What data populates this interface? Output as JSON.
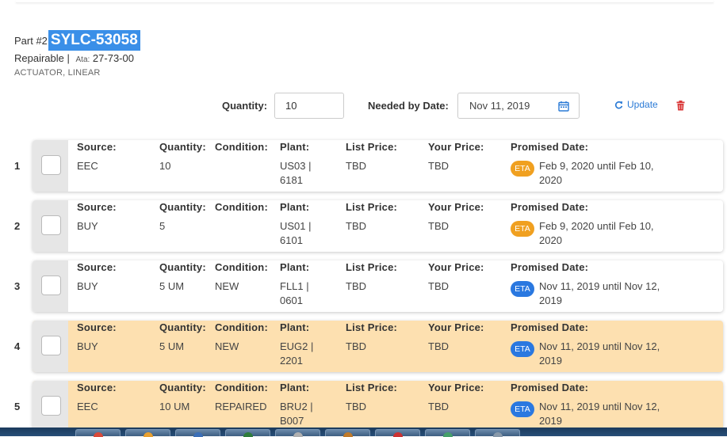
{
  "part": {
    "prefix": "Part #2",
    "number": "SYLC-53058",
    "repairable": "Repairable |",
    "ata_label": "Ata:",
    "ata_value": "27-73-00",
    "description": "ACTUATOR, LINEAR"
  },
  "controls": {
    "quantity_label": "Quantity:",
    "quantity_value": "10",
    "needed_label": "Needed by Date:",
    "needed_value": "Nov 11, 2019",
    "update_label": "Update"
  },
  "columns": {
    "source": "Source:",
    "quantity": "Quantity:",
    "condition": "Condition:",
    "plant": "Plant:",
    "list_price": "List Price:",
    "your_price": "Your Price:",
    "promised": "Promised Date:"
  },
  "eta_label": "ETA",
  "rows": [
    {
      "num": "1",
      "source": "EEC",
      "quantity": "10",
      "condition": "",
      "plant1": "US03 |",
      "plant2": "6181",
      "list_price": "TBD",
      "your_price": "TBD",
      "promised": "Feb 9, 2020 until Feb 10, 2020",
      "eta_color": "orange",
      "highlight": false
    },
    {
      "num": "2",
      "source": "BUY",
      "quantity": "5",
      "condition": "",
      "plant1": "US01 |",
      "plant2": "6101",
      "list_price": "TBD",
      "your_price": "TBD",
      "promised": "Feb 9, 2020 until Feb 10, 2020",
      "eta_color": "orange",
      "highlight": false
    },
    {
      "num": "3",
      "source": "BUY",
      "quantity": "5 UM",
      "condition": "NEW",
      "plant1": "FLL1 |",
      "plant2": "0601",
      "list_price": "TBD",
      "your_price": "TBD",
      "promised": "Nov 11, 2019 until Nov 12, 2019",
      "eta_color": "blue",
      "highlight": false
    },
    {
      "num": "4",
      "source": "BUY",
      "quantity": "5 UM",
      "condition": "NEW",
      "plant1": "EUG2 |",
      "plant2": "2201",
      "list_price": "TBD",
      "your_price": "TBD",
      "promised": "Nov 11, 2019 until Nov 12, 2019",
      "eta_color": "blue",
      "highlight": true
    },
    {
      "num": "5",
      "source": "EEC",
      "quantity": "10 UM",
      "condition": "REPAIRED",
      "plant1": "BRU2 |",
      "plant2": "B007",
      "list_price": "TBD",
      "your_price": "TBD",
      "promised": "Nov 11, 2019 until Nov 12, 2019",
      "eta_color": "blue",
      "highlight": true
    }
  ],
  "colors": {
    "accent": "#3a8fe8",
    "highlight_row": "#fde0b0",
    "eta_orange": "#f0a020",
    "eta_blue": "#2a78e0",
    "delete_red": "#d93636"
  },
  "taskbar": {
    "buttons": [
      "chrome-icon",
      "app-icon",
      "app-icon",
      "outlook-icon",
      "excel-icon",
      "app-icon",
      "app-icon",
      "app-icon",
      "app-icon"
    ]
  }
}
